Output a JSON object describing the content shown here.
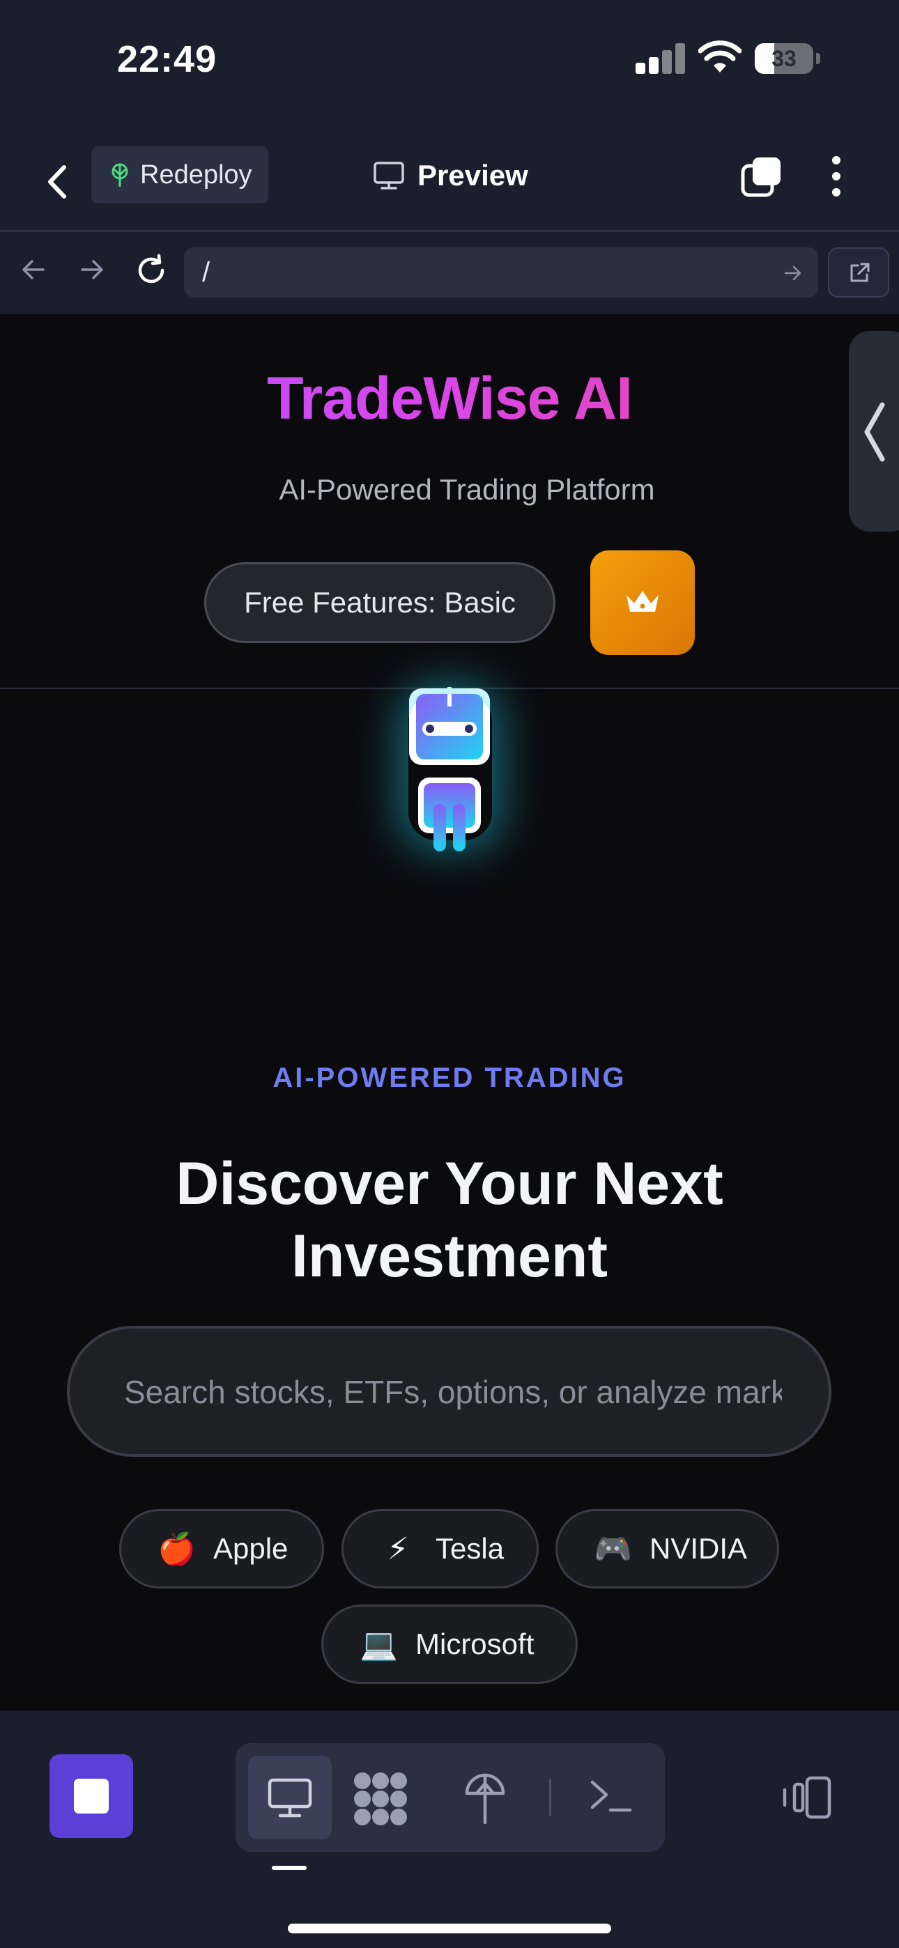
{
  "status_bar": {
    "time": "22:49",
    "battery": "33",
    "battery_level": 0.33
  },
  "app_header": {
    "redeploy_label": "Redeploy",
    "preview_label": "Preview"
  },
  "url_bar": {
    "path": "/"
  },
  "hero": {
    "title": "TradeWise AI",
    "subtitle": "AI-Powered Trading Platform",
    "features_pill": "Free Features: Basic"
  },
  "discover": {
    "eyebrow": "AI-POWERED TRADING",
    "headline_line1": "Discover Your Next",
    "headline_line2": "Investment",
    "search_placeholder": "Search stocks, ETFs, options, or analyze market trends",
    "chips": [
      {
        "emoji": "🍎",
        "label": "Apple"
      },
      {
        "emoji": "⚡",
        "label": "Tesla"
      },
      {
        "emoji": "🎮",
        "label": "NVIDIA"
      },
      {
        "emoji": "💻",
        "label": "Microsoft"
      }
    ]
  },
  "colors": {
    "accent": "#5b3fd6",
    "premium": "#f59e0b",
    "eyebrow": "#6f7cf0",
    "brand_gradient": [
      "#a855f7",
      "#ec4899"
    ]
  },
  "icons": {
    "redeploy": "deploy-tree-icon",
    "preview": "monitor-icon",
    "premium": "crown-icon",
    "toolbar": [
      "monitor-icon",
      "apps-grid-icon",
      "deploy-icon",
      "terminal-icon",
      "devices-icon"
    ]
  }
}
